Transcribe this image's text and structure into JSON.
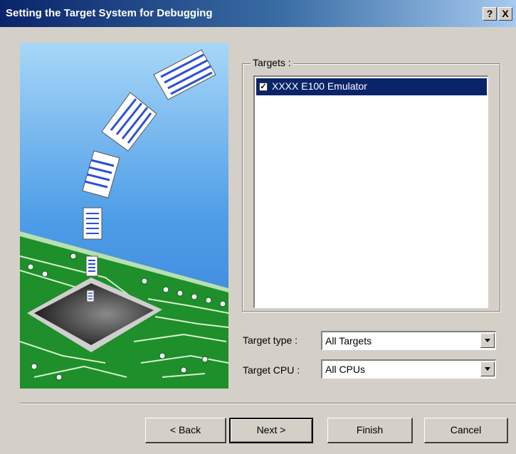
{
  "window": {
    "title": "Setting the Target System for Debugging",
    "help_label": "?",
    "close_label": "X"
  },
  "targets": {
    "group_label": "Targets :",
    "items": [
      {
        "label": "XXXX E100 Emulator",
        "checked": true,
        "selected": true
      }
    ]
  },
  "target_type": {
    "label": "Target type :",
    "value": "All Targets"
  },
  "target_cpu": {
    "label": "Target CPU :",
    "value": "All CPUs"
  },
  "buttons": {
    "back": "< Back",
    "next": "Next >",
    "finish": "Finish",
    "cancel": "Cancel"
  },
  "illustration": {
    "name": "wizard-illustration-chip-with-documents"
  }
}
